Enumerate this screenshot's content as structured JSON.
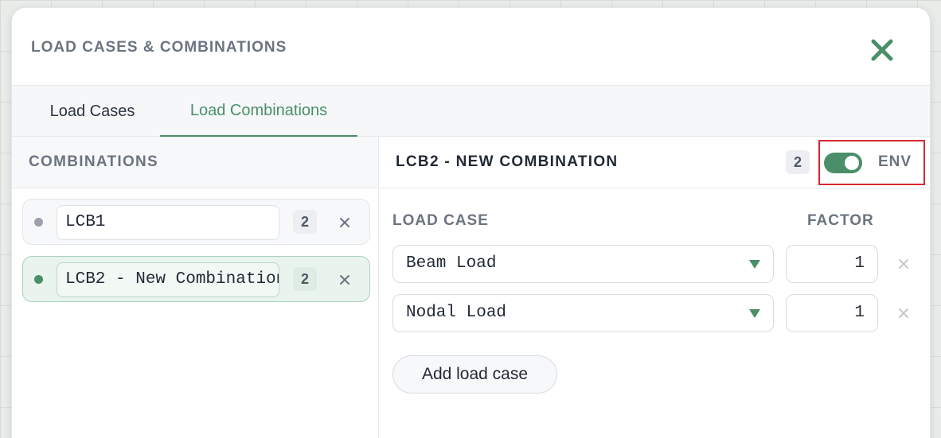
{
  "modal": {
    "title": "LOAD CASES & COMBINATIONS",
    "close_icon": "close-icon",
    "accent_color": "#4a8f69"
  },
  "tabs": [
    {
      "label": "Load Cases",
      "active": false
    },
    {
      "label": "Load Combinations",
      "active": true
    }
  ],
  "sidebar": {
    "header": "COMBINATIONS",
    "items": [
      {
        "name": "LCB1",
        "count": "2",
        "selected": false
      },
      {
        "name": "LCB2 - New Combination",
        "count": "2",
        "selected": true
      }
    ]
  },
  "detail": {
    "title": "LCB2 - NEW COMBINATION",
    "count": "2",
    "env_label": "ENV",
    "env_enabled": true,
    "col_load_case": "LOAD CASE",
    "col_factor": "FACTOR",
    "rows": [
      {
        "load_case": "Beam Load",
        "factor": "1"
      },
      {
        "load_case": "Nodal Load",
        "factor": "1"
      }
    ],
    "add_button": "Add load case"
  }
}
